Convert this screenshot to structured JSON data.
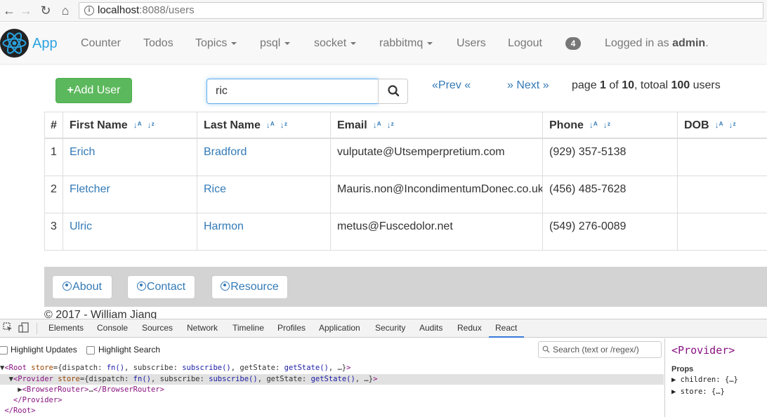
{
  "browser": {
    "host": "localhost",
    "path": ":8088/users"
  },
  "navbar": {
    "brand": "App",
    "items": [
      {
        "label": "Counter",
        "dropdown": false
      },
      {
        "label": "Todos",
        "dropdown": false
      },
      {
        "label": "Topics",
        "dropdown": true
      },
      {
        "label": "psql",
        "dropdown": true
      },
      {
        "label": "socket",
        "dropdown": true
      },
      {
        "label": "rabbitmq",
        "dropdown": true
      },
      {
        "label": "Users",
        "dropdown": false
      },
      {
        "label": "Logout",
        "dropdown": false
      }
    ],
    "badge": "4",
    "logged_prefix": "Logged in as ",
    "logged_user": "admin",
    "logged_suffix": "."
  },
  "toolbar": {
    "add_label": "Add User",
    "search_value": "ric",
    "prev_label": "«Prev «",
    "next_label": "» Next »",
    "page_prefix": "page ",
    "page_current": "1",
    "page_of": " of ",
    "page_total": "10",
    "page_mid": ", totoal ",
    "user_total": "100",
    "page_suffix": " users"
  },
  "table": {
    "headers": [
      "#",
      "First Name",
      "Last Name",
      "Email",
      "Phone",
      "DOB"
    ],
    "rows": [
      {
        "num": "1",
        "first": "Erich",
        "last": "Bradford",
        "email": "vulputate@Utsemperpretium.com",
        "phone": "(929) 357-5138",
        "dob": ""
      },
      {
        "num": "2",
        "first": "Fletcher",
        "last": "Rice",
        "email": "Mauris.non@IncondimentumDonec.co.uk",
        "phone": "(456) 485-7628",
        "dob": ""
      },
      {
        "num": "3",
        "first": "Ulric",
        "last": "Harmon",
        "email": "metus@Fuscedolor.net",
        "phone": "(549) 276-0089",
        "dob": ""
      }
    ]
  },
  "footer": {
    "buttons": [
      "About",
      "Contact",
      "Resource"
    ],
    "copyright": "© 2017 - William Jiang"
  },
  "devtools": {
    "tabs": [
      "Elements",
      "Console",
      "Sources",
      "Network",
      "Timeline",
      "Profiles",
      "Application",
      "Security",
      "Audits",
      "Redux",
      "React"
    ],
    "active_tab": "React",
    "options": [
      "Highlight Updates",
      "Highlight Search"
    ],
    "search_placeholder": "Search (text or /regex/)",
    "side_title": "<Provider>",
    "props_heading": "Props",
    "props": [
      "children: {…}",
      "store: {…}"
    ]
  }
}
